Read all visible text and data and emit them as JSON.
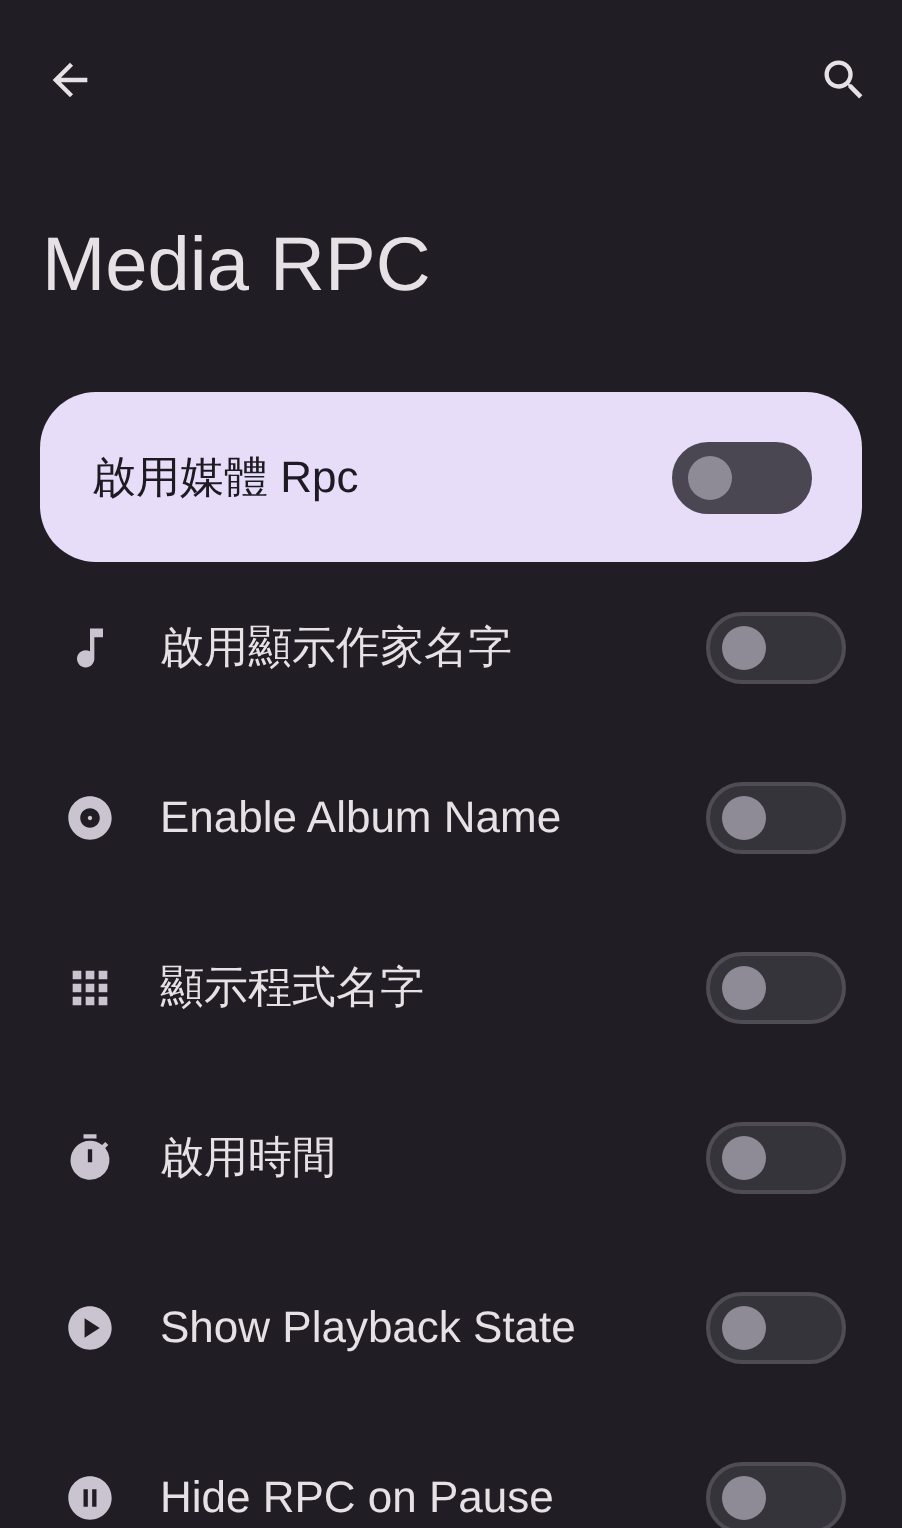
{
  "title": "Media RPC",
  "main_toggle": {
    "label": "啟用媒體 Rpc",
    "on": false
  },
  "settings": [
    {
      "label": "啟用顯示作家名字",
      "on": false
    },
    {
      "label": "Enable Album Name",
      "on": false
    },
    {
      "label": "顯示程式名字",
      "on": false
    },
    {
      "label": "啟用時間",
      "on": false
    },
    {
      "label": "Show Playback State",
      "on": false
    },
    {
      "label": "Hide RPC on Pause",
      "on": false
    }
  ]
}
